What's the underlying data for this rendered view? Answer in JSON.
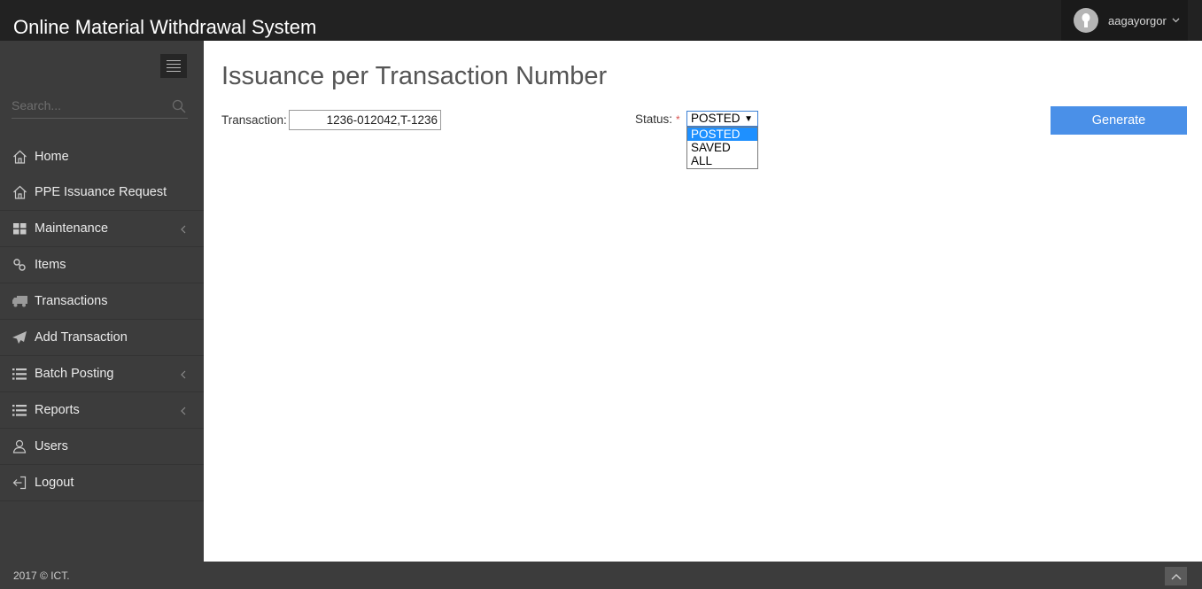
{
  "header": {
    "title": "Online Material Withdrawal System",
    "user": {
      "name": "aagayorgor",
      "avatar_icon": "user-avatar-icon",
      "chevron_icon": "chevron-down-icon"
    }
  },
  "sidebar": {
    "search": {
      "placeholder": "Search..."
    },
    "items": [
      {
        "label": "Home",
        "icon": "home-icon"
      },
      {
        "label": "PPE Issuance Request",
        "icon": "home-icon"
      },
      {
        "label": "Maintenance",
        "icon": "grid-icon",
        "expandable": true
      },
      {
        "label": "Items",
        "icon": "link-icon"
      },
      {
        "label": "Transactions",
        "icon": "truck-icon"
      },
      {
        "label": "Add Transaction",
        "icon": "paper-plane-icon"
      },
      {
        "label": "Batch Posting",
        "icon": "list-icon",
        "expandable": true
      },
      {
        "label": "Reports",
        "icon": "list-icon",
        "expandable": true
      },
      {
        "label": "Users",
        "icon": "users-icon"
      },
      {
        "label": "Logout",
        "icon": "logout-icon"
      }
    ]
  },
  "main": {
    "title": "Issuance per Transaction Number",
    "transaction": {
      "label": "Transaction:",
      "value": "1236-012042,T-1236"
    },
    "status": {
      "label": "Status:",
      "required_mark": "*",
      "selected": "POSTED",
      "options": [
        "POSTED",
        "SAVED",
        "ALL"
      ]
    },
    "generate_label": "Generate"
  },
  "footer": {
    "text": "2017 © ICT."
  },
  "colors": {
    "topbar": "#222222",
    "sidebar": "#3c3c3c",
    "accent": "#4a90e8",
    "selected_option": "#1e90ff",
    "required": "#d9534f"
  }
}
